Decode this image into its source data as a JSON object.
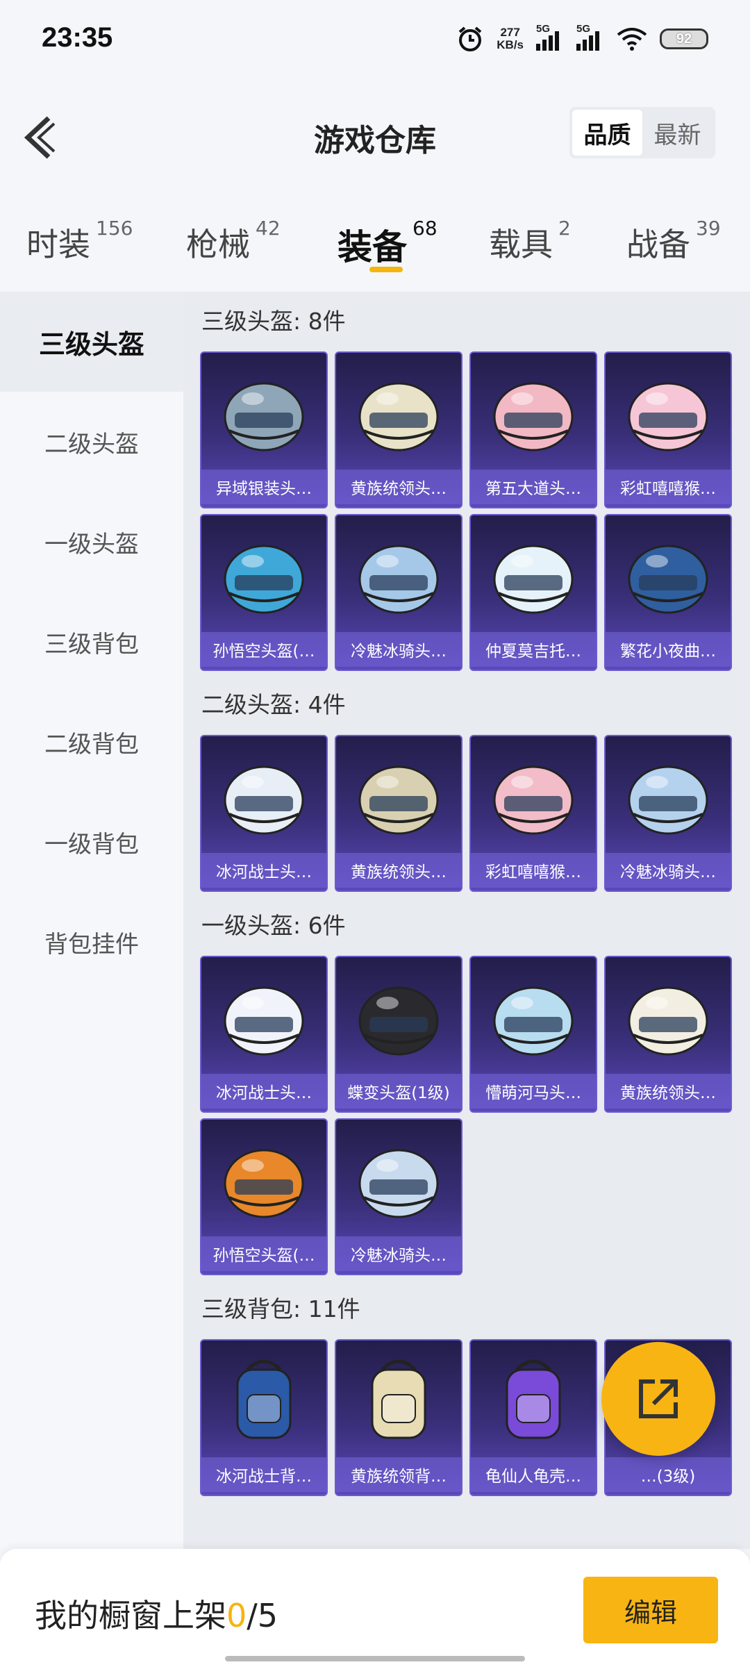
{
  "status_bar": {
    "time": "23:35",
    "net_speed": "277",
    "net_unit": "KB/s",
    "sim1": "5G",
    "sim2": "5G",
    "battery": "92"
  },
  "header": {
    "title": "游戏仓库",
    "sort_options": [
      "品质",
      "最新"
    ],
    "sort_selected": "品质"
  },
  "tabs": [
    {
      "label": "时装",
      "count": "156"
    },
    {
      "label": "枪械",
      "count": "42"
    },
    {
      "label": "装备",
      "count": "68",
      "active": true
    },
    {
      "label": "载具",
      "count": "2"
    },
    {
      "label": "战备",
      "count": "39"
    }
  ],
  "sidebar": {
    "items": [
      "三级头盔",
      "二级头盔",
      "一级头盔",
      "三级背包",
      "二级背包",
      "一级背包",
      "背包挂件"
    ],
    "active": "三级头盔"
  },
  "sections": [
    {
      "title": "三级头盔: 8件",
      "items": [
        {
          "name": "异域银装头…",
          "icon": "level3-helmet-silver-icon",
          "color": "#8fa6b8"
        },
        {
          "name": "黄族统领头…",
          "icon": "level3-helmet-gold-white-icon",
          "color": "#e8e2c8"
        },
        {
          "name": "第五大道头…",
          "icon": "level3-helmet-pink-plaid-icon",
          "color": "#f2b8c4"
        },
        {
          "name": "彩虹嘻嘻猴…",
          "icon": "level3-helmet-pink-beanie-icon",
          "color": "#f6c6d6"
        },
        {
          "name": "孙悟空头盔(…",
          "icon": "level3-helmet-blue-orange-icon",
          "color": "#3fa8d8"
        },
        {
          "name": "冷魅冰骑头…",
          "icon": "level3-helmet-ice-knight-icon",
          "color": "#a6c8e8"
        },
        {
          "name": "仲夏莫吉托…",
          "icon": "level3-helmet-white-bow-icon",
          "color": "#e6f2fa"
        },
        {
          "name": "繁花小夜曲…",
          "icon": "level3-helmet-blue-gold-icon",
          "color": "#2f5f9f"
        }
      ]
    },
    {
      "title": "二级头盔: 4件",
      "items": [
        {
          "name": "冰河战士头…",
          "icon": "level2-helmet-white-blue-icon",
          "color": "#e8eef6"
        },
        {
          "name": "黄族统领头…",
          "icon": "level2-helmet-gold-black-icon",
          "color": "#d8d0b0"
        },
        {
          "name": "彩虹嘻嘻猴…",
          "icon": "level2-helmet-pink-icon",
          "color": "#f2bcc8"
        },
        {
          "name": "冷魅冰骑头…",
          "icon": "level2-helmet-ice-icon",
          "color": "#b4d2ee"
        }
      ]
    },
    {
      "title": "一级头盔: 6件",
      "items": [
        {
          "name": "冰河战士头…",
          "icon": "level1-helmet-white-blue-icon",
          "color": "#f0f4fa"
        },
        {
          "name": "蝶变头盔(1级)",
          "icon": "level1-helmet-black-icon",
          "color": "#2a2a2e"
        },
        {
          "name": "懵萌河马头…",
          "icon": "level1-helmet-light-blue-icon",
          "color": "#b8dcf0"
        },
        {
          "name": "黄族统领头…",
          "icon": "level1-helmet-white-gold-icon",
          "color": "#f2eee2"
        },
        {
          "name": "孙悟空头盔(…",
          "icon": "level1-helmet-orange-black-icon",
          "color": "#e8882a"
        },
        {
          "name": "冷魅冰骑头…",
          "icon": "level1-helmet-silver-blue-icon",
          "color": "#c8daee"
        }
      ]
    },
    {
      "title": "三级背包: 11件",
      "items": [
        {
          "name": "冰河战士背…",
          "icon": "level3-backpack-blue-white-icon",
          "color": "#2a5aa8"
        },
        {
          "name": "黄族统领背…",
          "icon": "level3-backpack-gold-white-icon",
          "color": "#e8dcb4"
        },
        {
          "name": "龟仙人龟壳…",
          "icon": "level3-backpack-turtle-shell-icon",
          "color": "#7a4ad8"
        },
        {
          "name": "…(3级)",
          "icon": "level3-backpack-black-icon",
          "color": "#3a3a3a"
        }
      ]
    }
  ],
  "bottom_bar": {
    "shelf_label": "我的橱窗上架",
    "shelf_count": "0",
    "shelf_total": "/5",
    "edit_label": "编辑"
  }
}
